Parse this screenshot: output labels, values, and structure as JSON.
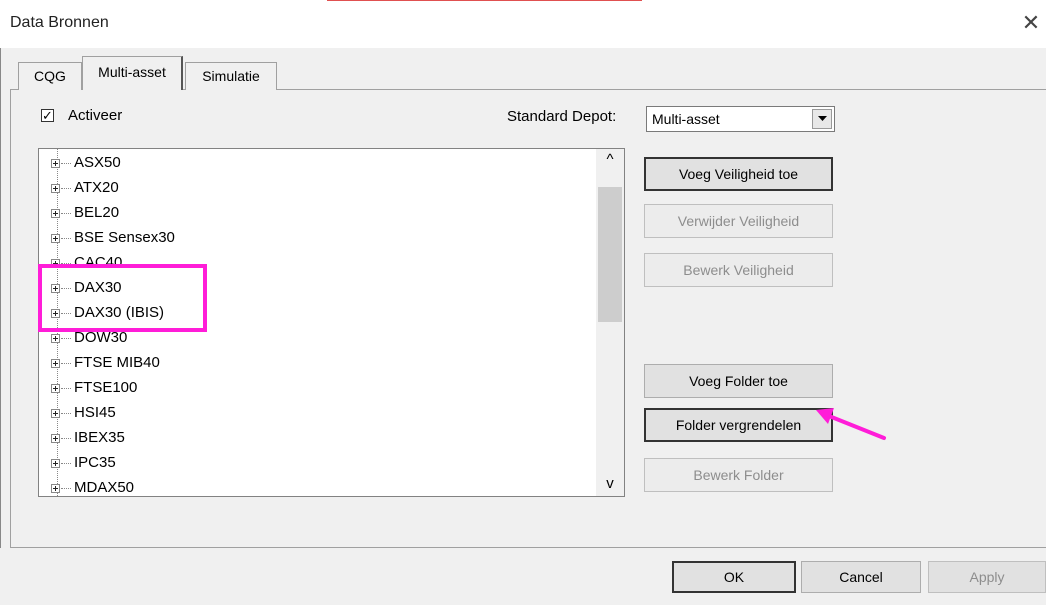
{
  "window": {
    "title": "Data Bronnen",
    "close_glyph": "✕"
  },
  "tabs": [
    {
      "label": "CQG"
    },
    {
      "label": "Multi-asset"
    },
    {
      "label": "Simulatie"
    }
  ],
  "activate": {
    "label": "Activeer",
    "checked_glyph": "✓"
  },
  "depot": {
    "label": "Standard Depot:",
    "value": "Multi-asset"
  },
  "tree": {
    "items": [
      {
        "label": "ASX50"
      },
      {
        "label": "ATX20"
      },
      {
        "label": "BEL20"
      },
      {
        "label": "BSE Sensex30"
      },
      {
        "label": "CAC40"
      },
      {
        "label": "DAX30"
      },
      {
        "label": "DAX30 (IBIS)"
      },
      {
        "label": "DOW30"
      },
      {
        "label": "FTSE MIB40"
      },
      {
        "label": "FTSE100"
      },
      {
        "label": "HSI45"
      },
      {
        "label": "IBEX35"
      },
      {
        "label": "IPC35"
      },
      {
        "label": "MDAX50"
      }
    ],
    "scroll_up_glyph": "^",
    "scroll_down_glyph": "v"
  },
  "actions": {
    "add_security": "Voeg Veiligheid toe",
    "remove_security": "Verwijder Veiligheid",
    "edit_security": "Bewerk Veiligheid",
    "add_folder": "Voeg Folder toe",
    "lock_folder": "Folder vergrendelen",
    "edit_folder": "Bewerk Folder"
  },
  "dialog": {
    "ok": "OK",
    "cancel": "Cancel",
    "apply": "Apply"
  },
  "annotation": {
    "color": "#ff1dd8"
  }
}
